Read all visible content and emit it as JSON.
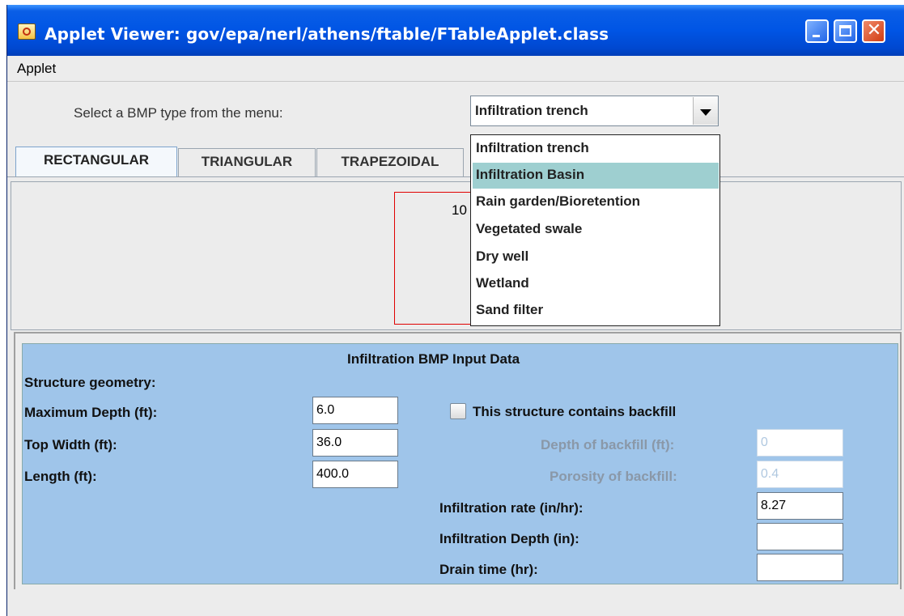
{
  "window": {
    "title": "Applet Viewer: gov/epa/nerl/athens/ftable/FTableApplet.class"
  },
  "menubar": {
    "applet": "Applet"
  },
  "selector": {
    "prompt": "Select a BMP type from the menu:",
    "selected": "Infiltration trench"
  },
  "tabs": [
    {
      "label": "RECTANGULAR",
      "active": true
    },
    {
      "label": "TRIANGULAR",
      "active": false
    },
    {
      "label": "TRAPEZOIDAL",
      "active": false
    }
  ],
  "drawing": {
    "label": "10"
  },
  "dropdown": {
    "items": [
      {
        "label": "Infiltration trench",
        "highlighted": false
      },
      {
        "label": "Infiltration Basin",
        "highlighted": true
      },
      {
        "label": "Rain garden/Bioretention",
        "highlighted": false
      },
      {
        "label": "Vegetated swale",
        "highlighted": false
      },
      {
        "label": "Dry well",
        "highlighted": false
      },
      {
        "label": "Wetland",
        "highlighted": false
      },
      {
        "label": "Sand filter",
        "highlighted": false
      }
    ]
  },
  "form": {
    "title": "Infiltration BMP Input Data",
    "geometry_label": "Structure geometry:",
    "max_depth": {
      "label": "Maximum  Depth (ft):",
      "value": "6.0"
    },
    "top_width": {
      "label": "Top Width (ft):",
      "value": "36.0"
    },
    "length": {
      "label": "Length (ft):",
      "value": "400.0"
    },
    "backfill_checkbox": {
      "label": "This structure contains backfill",
      "checked": false
    },
    "depth_backfill": {
      "label": "Depth of backfill (ft):",
      "value": "0"
    },
    "porosity_backfill": {
      "label": "Porosity of backfill:",
      "value": "0.4"
    },
    "infiltration_rate": {
      "label": "Infiltration rate (in/hr):",
      "value": "8.27"
    },
    "infiltration_depth": {
      "label": "Infiltration Depth (in):",
      "value": ""
    },
    "drain_time": {
      "label": "Drain time (hr):",
      "value": ""
    }
  },
  "colors": {
    "titlebar": "#0055e5",
    "form_panel": "#9fc5ea",
    "highlight": "#9ecfd0",
    "drawing_rect": "#e00000"
  }
}
